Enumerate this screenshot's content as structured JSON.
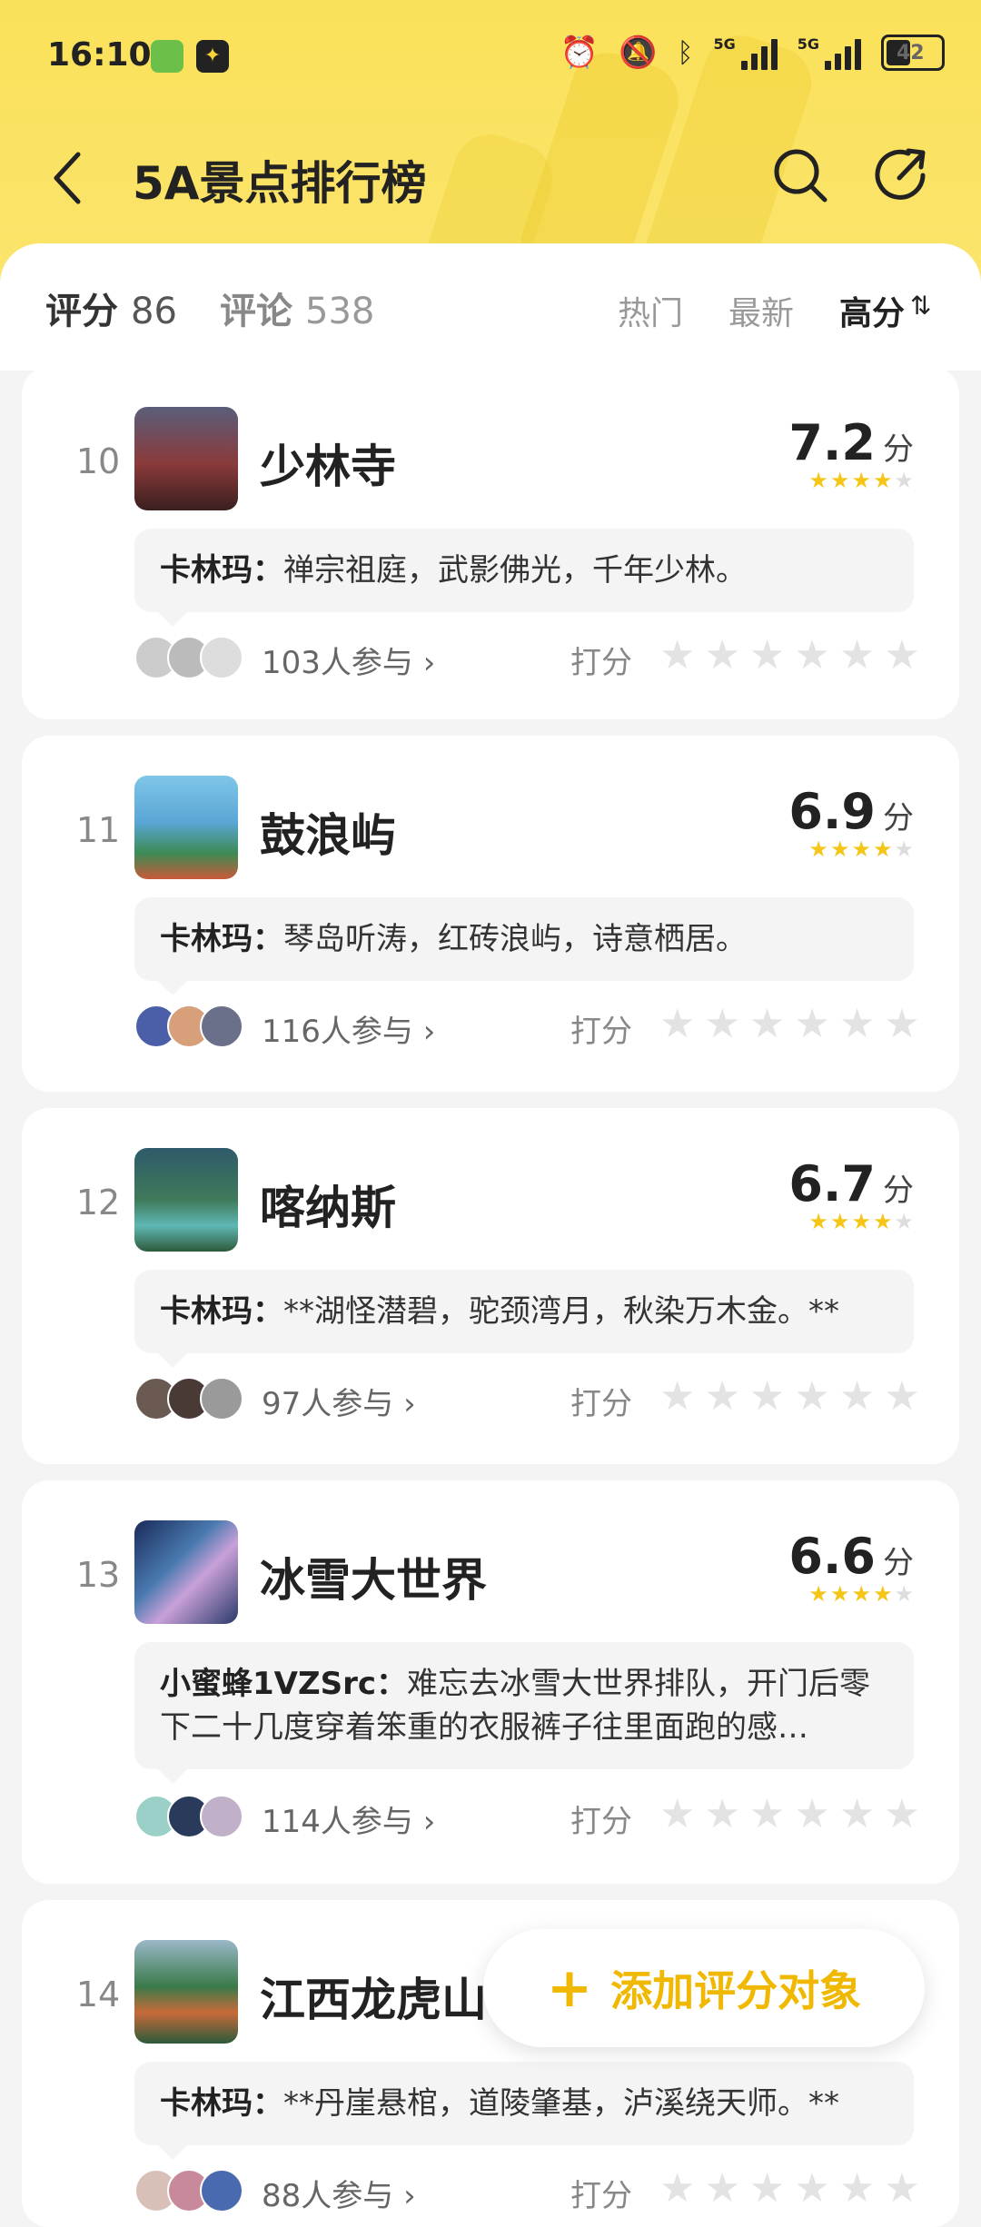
{
  "status_bar": {
    "time": "16:10",
    "network_label": "5G",
    "battery": "42"
  },
  "header": {
    "title": "5A景点排行榜",
    "icons": [
      "back-arrow-icon",
      "search-icon",
      "share-icon"
    ]
  },
  "stats": {
    "score_label": "评分",
    "score_count": "86",
    "comment_label": "评论",
    "comment_count": "538"
  },
  "sort_tabs": {
    "hot": "热门",
    "new": "最新",
    "high": "高分",
    "active": "高分"
  },
  "colors": {
    "header_yellow": "#fbe15a",
    "star_yellow": "#f5c518",
    "accent": "#f0b800"
  },
  "items": [
    {
      "rank": "10",
      "name": "少林寺",
      "score": "7.2",
      "unit": "分",
      "stars_filled": 3.5,
      "comment_user": "卡林玛：",
      "comment_text": "禅宗祖庭，武影佛光，千年少林。",
      "participants": "103人参与",
      "rate_label": "打分"
    },
    {
      "rank": "11",
      "name": "鼓浪屿",
      "score": "6.9",
      "unit": "分",
      "stars_filled": 3.5,
      "comment_user": "卡林玛：",
      "comment_text": "琴岛听涛，红砖浪屿，诗意栖居。",
      "participants": "116人参与",
      "rate_label": "打分"
    },
    {
      "rank": "12",
      "name": "喀纳斯",
      "score": "6.7",
      "unit": "分",
      "stars_filled": 3.5,
      "comment_user": "卡林玛：",
      "comment_text": "**湖怪潜碧，驼颈湾月，秋染万木金。**",
      "participants": "97人参与",
      "rate_label": "打分"
    },
    {
      "rank": "13",
      "name": "冰雪大世界",
      "score": "6.6",
      "unit": "分",
      "stars_filled": 3.5,
      "comment_user": "小蜜蜂1VZSrc：",
      "comment_text": "难忘去冰雪大世界排队，开门后零下二十几度穿着笨重的衣服裤子往里面跑的感…",
      "participants": "114人参与",
      "rate_label": "打分"
    },
    {
      "rank": "14",
      "name": "江西龙虎山",
      "score": "",
      "unit": "",
      "stars_filled": 0,
      "comment_user": "卡林玛：",
      "comment_text": "**丹崖悬棺，道陵肇基，泸溪绕天师。**",
      "participants": "88人参与",
      "rate_label": "打分"
    }
  ],
  "fab": {
    "label": "添加评分对象"
  }
}
